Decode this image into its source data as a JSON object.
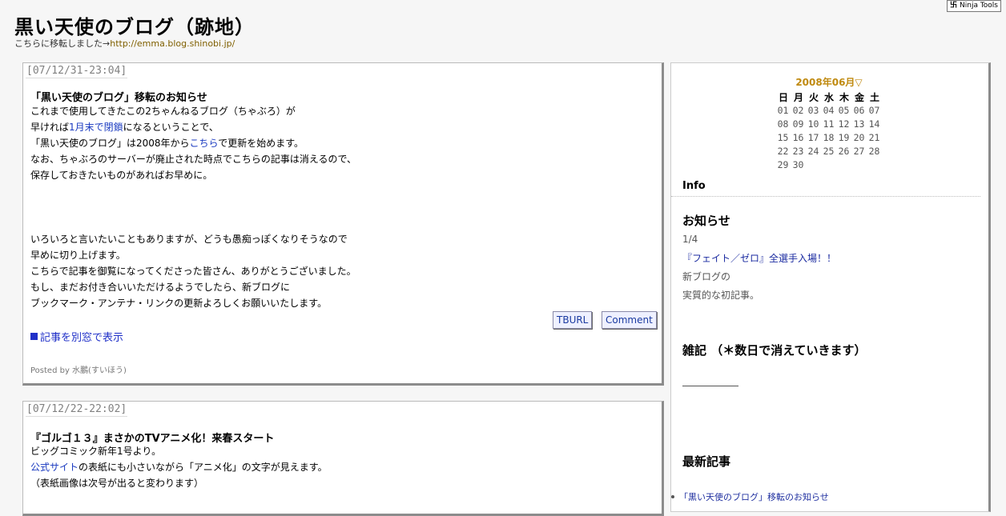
{
  "ninja": {
    "label": "Ninja Tools",
    "icon": "卐"
  },
  "header": {
    "title": "黒い天使のブログ（跡地）",
    "subtitle_prefix": "こちらに移転しました→",
    "subtitle_link": "http://emma.blog.shinobi.jp/"
  },
  "entries": [
    {
      "date": "[07/12/31-23:04]",
      "title": "「黒い天使のブログ」移転のお知らせ",
      "lines_top": [
        "これまで使用してきたこの2ちゃんねるブログ（ちゃぶろ）が"
      ],
      "line2": {
        "a": "早ければ",
        "b": "1月末で閉鎖",
        "c": "になるということで、"
      },
      "line3": {
        "a": "「黒い天使のブログ」は2008年から",
        "b": "こちら",
        "c": "で更新を始めます。"
      },
      "lines_mid": [
        "なお、ちゃぶろのサーバーが廃止された時点でこちらの記事は消えるので、",
        "保存しておきたいものがあればお早めに。"
      ],
      "lines_bottom": [
        "いろいろと言いたいこともありますが、どうも愚痴っぽくなりそうなので",
        "早めに切り上げます。",
        "こちらで記事を御覧になってくださった皆さん、ありがとうございました。",
        "もし、まだお付き合いいただけるようでしたら、新ブログに",
        "ブックマーク・アンテナ・リンクの更新よろしくお願いいたします。"
      ],
      "tburl": "TBURL",
      "comment": "Comment",
      "more": "記事を別窓で表示",
      "posted": "Posted by 水鵬(すいほう)"
    },
    {
      "date": "[07/12/22-22:02]",
      "title": "『ゴルゴ１３』まさかのTVアニメ化！来春スタート",
      "line1": "ビッグコミック新年1号より。",
      "line2": {
        "a": "公式サイト",
        "b": "の表紙にも小さいながら「アニメ化」の文字が見えます。"
      },
      "line3": "（表紙画像は次号が出ると変わります）"
    }
  ],
  "sidebar": {
    "calendar": {
      "header": "2008年06月▽",
      "dow": [
        "日",
        "月",
        "火",
        "水",
        "木",
        "金",
        "土"
      ],
      "weeks": [
        [
          "01",
          "02",
          "03",
          "04",
          "05",
          "06",
          "07"
        ],
        [
          "08",
          "09",
          "10",
          "11",
          "12",
          "13",
          "14"
        ],
        [
          "15",
          "16",
          "17",
          "18",
          "19",
          "20",
          "21"
        ],
        [
          "22",
          "23",
          "24",
          "25",
          "26",
          "27",
          "28"
        ],
        [
          "29",
          "30",
          "",
          "",
          "",
          "",
          ""
        ]
      ]
    },
    "info_title": "Info",
    "news_title": "お知らせ",
    "news_date": "1/4",
    "news_link": "『フェイト／ゼロ』全選手入場！！",
    "news_line1": "新ブログの",
    "news_line2": "実質的な初記事。",
    "misc_title": "雑記 （＊数日で消えていきます）",
    "recent_title": "最新記事",
    "recent_items": [
      "「黒い天使のブログ」移転のお知らせ"
    ]
  }
}
